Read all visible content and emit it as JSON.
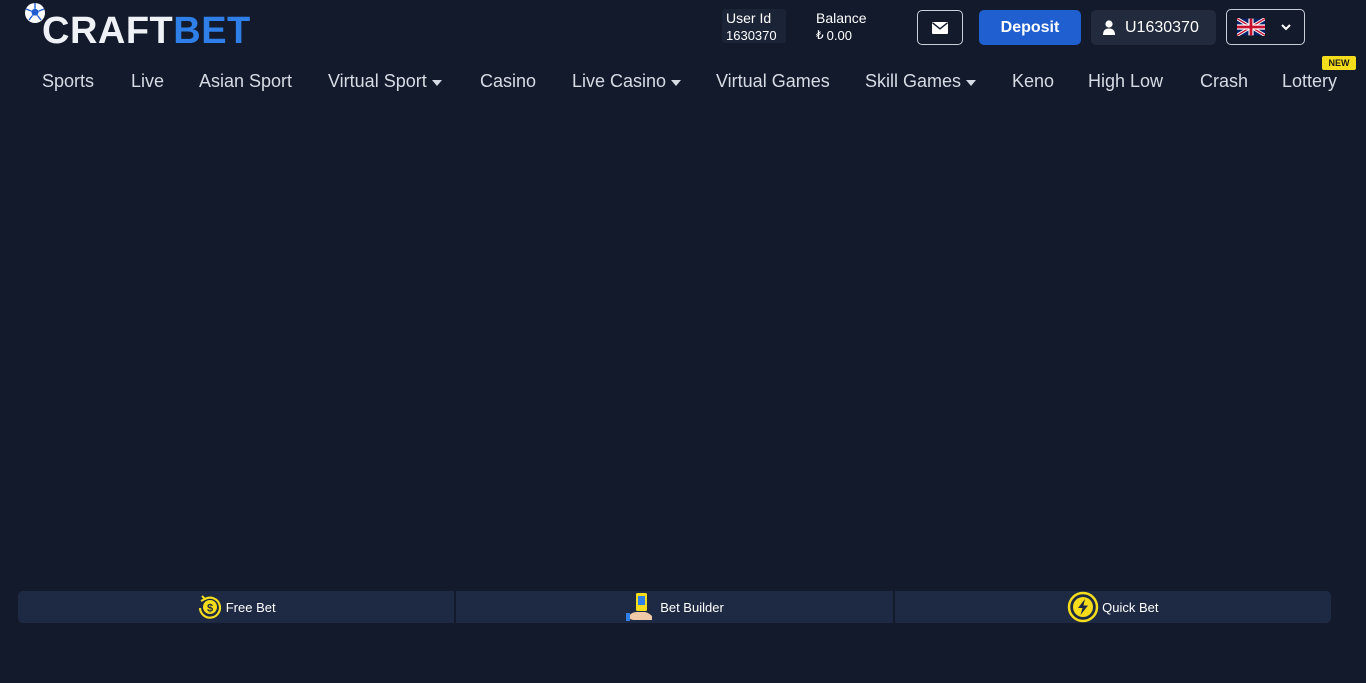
{
  "brand": {
    "part1": "CRAFT",
    "part2": "BET",
    "accent_color": "#2f7fe8"
  },
  "header": {
    "user_id_label": "User Id",
    "user_id_value": "1630370",
    "balance_label": "Balance",
    "balance_currency_icon": "₺",
    "balance_value": "0.00",
    "mail_icon": "envelope-icon",
    "deposit_label": "Deposit",
    "account_name": "U1630370",
    "language_flag": "uk-flag-icon"
  },
  "nav": {
    "items": [
      {
        "label": "Sports"
      },
      {
        "label": "Live"
      },
      {
        "label": "Asian Sport"
      },
      {
        "label": "Virtual Sport",
        "dropdown": true
      },
      {
        "label": "Casino"
      },
      {
        "label": "Live Casino",
        "dropdown": true
      },
      {
        "label": "Virtual Games"
      },
      {
        "label": "Skill Games",
        "dropdown": true
      },
      {
        "label": "Keno"
      },
      {
        "label": "High Low"
      },
      {
        "label": "Crash"
      },
      {
        "label": "Lottery"
      }
    ],
    "new_badge": "NEW"
  },
  "quickbar": {
    "items": [
      {
        "label": "Free Bet",
        "icon": "free-bet-coin-icon"
      },
      {
        "label": "Bet Builder",
        "icon": "bet-builder-phone-icon"
      },
      {
        "label": "Quick Bet",
        "icon": "lightning-icon"
      }
    ]
  },
  "colors": {
    "background": "#131a2c",
    "deposit": "#1f5fd0",
    "badge": "#f5dd1b",
    "quickbar": "#1e2a44"
  }
}
